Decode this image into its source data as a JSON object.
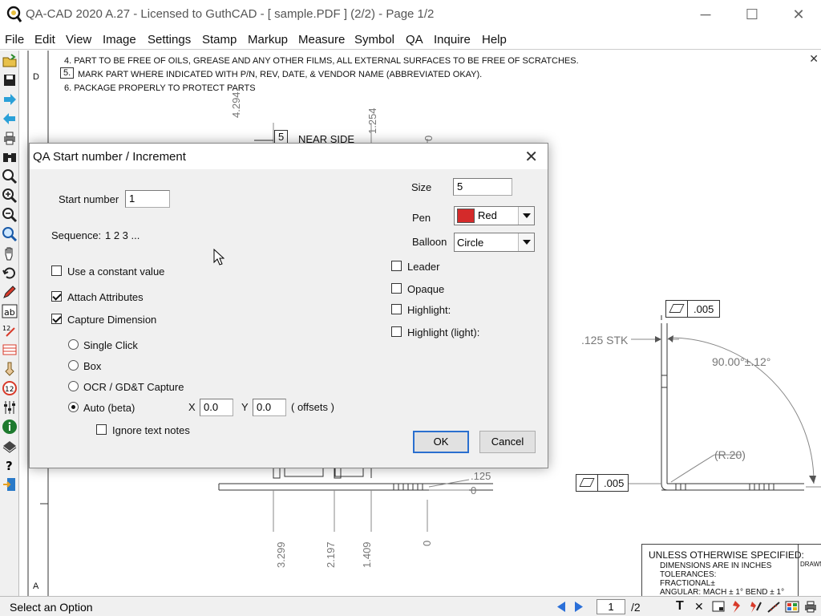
{
  "window": {
    "title": "QA-CAD 2020 A.27 - Licensed to GuthCAD  -  [ sample.PDF ] (2/2)  -  Page 1/2",
    "minimize": "─",
    "maximize": "☐",
    "close": "✕"
  },
  "menu": [
    "File",
    "Edit",
    "View",
    "Image",
    "Settings",
    "Stamp",
    "Markup",
    "Measure",
    "Symbol",
    "QA",
    "Inquire",
    "Help"
  ],
  "toolbar_icons": [
    "open-icon",
    "save-icon",
    "forward-arrow-icon",
    "back-arrow-icon",
    "print-icon",
    "binoculars-icon",
    "zoom-icon",
    "zoom-in-icon",
    "zoom-out-icon",
    "zoom-window-icon",
    "hand-pan-icon",
    "undo-icon",
    "pen-icon",
    "text-ab-icon",
    "number-tag-icon",
    "table-icon",
    "pointer-icon",
    "balloon-12-icon",
    "sliders-icon",
    "info-icon",
    "stamp-icon",
    "help-icon",
    "exit-icon"
  ],
  "drawing": {
    "notes": [
      "4.  PART TO BE FREE OF OILS, GREASE AND ANY OTHER FILMS, ALL EXTERNAL SURFACES TO BE FREE OF SCRATCHES.",
      "MARK PART WHERE INDICATED WITH P/N, REV, DATE, & VENDOR NAME (ABBREVIATED OKAY).",
      "6.  PACKAGE PROPERLY TO PROTECT PARTS"
    ],
    "note5_num": "5.",
    "zone_d": "D",
    "zone_a": "A",
    "near_side_num": "5",
    "near_side": "NEAR SIDE",
    "dim_top": [
      "4.294",
      "1.254",
      "0"
    ],
    "dim_bottom": [
      "3.299",
      "2.197",
      "1.409",
      "0"
    ],
    "dim_125": ".125",
    "dim_0": "0",
    "flatness_1": ".005",
    "flatness_2": ".005",
    "stk": ".125 STK",
    "angle": "90.00°±.12°",
    "radius": "(R.20)",
    "spec_title": "UNLESS OTHERWISE SPECIFIED:",
    "spec_lines": [
      "DIMENSIONS ARE IN INCHES",
      "TOLERANCES:",
      "FRACTIONAL±",
      "ANGULAR: MACH ± 1°  BEND ± 1°"
    ],
    "spec_side": "DRAWN",
    "close": "✕"
  },
  "dialog": {
    "title": "QA Start number / Increment",
    "close": "✕",
    "start_number_label": "Start number",
    "start_number_value": "1",
    "sequence_label": "Sequence:",
    "sequence_value": "1 2 3 ...",
    "size_label": "Size",
    "size_value": "5",
    "pen_label": "Pen",
    "pen_value": "Red",
    "pen_color": "#d42a2a",
    "balloon_label": "Balloon",
    "balloon_value": "Circle",
    "use_constant": {
      "label": "Use a constant value",
      "checked": false
    },
    "attach_attributes": {
      "label": "Attach Attributes",
      "checked": true
    },
    "capture_dimension": {
      "label": "Capture Dimension",
      "checked": true
    },
    "leader": {
      "label": "Leader",
      "checked": false
    },
    "opaque": {
      "label": "Opaque",
      "checked": false
    },
    "highlight": {
      "label": "Highlight:",
      "checked": false
    },
    "highlight_light": {
      "label": "Highlight (light):",
      "checked": false
    },
    "capture_modes": [
      {
        "label": "Single Click",
        "selected": false
      },
      {
        "label": "Box",
        "selected": false
      },
      {
        "label": "OCR / GD&T Capture",
        "selected": false
      },
      {
        "label": "Auto (beta)",
        "selected": true
      }
    ],
    "x_label": "X",
    "x_value": "0.0",
    "y_label": "Y",
    "y_value": "0.0",
    "offsets_label": "( offsets )",
    "ignore_text": {
      "label": "Ignore text notes",
      "checked": false
    },
    "ok": "OK",
    "cancel": "Cancel"
  },
  "statusbar": {
    "text": "Select an Option",
    "page_current": "1",
    "page_total": "/2",
    "tool_text": "T",
    "tool_x": "✕"
  }
}
